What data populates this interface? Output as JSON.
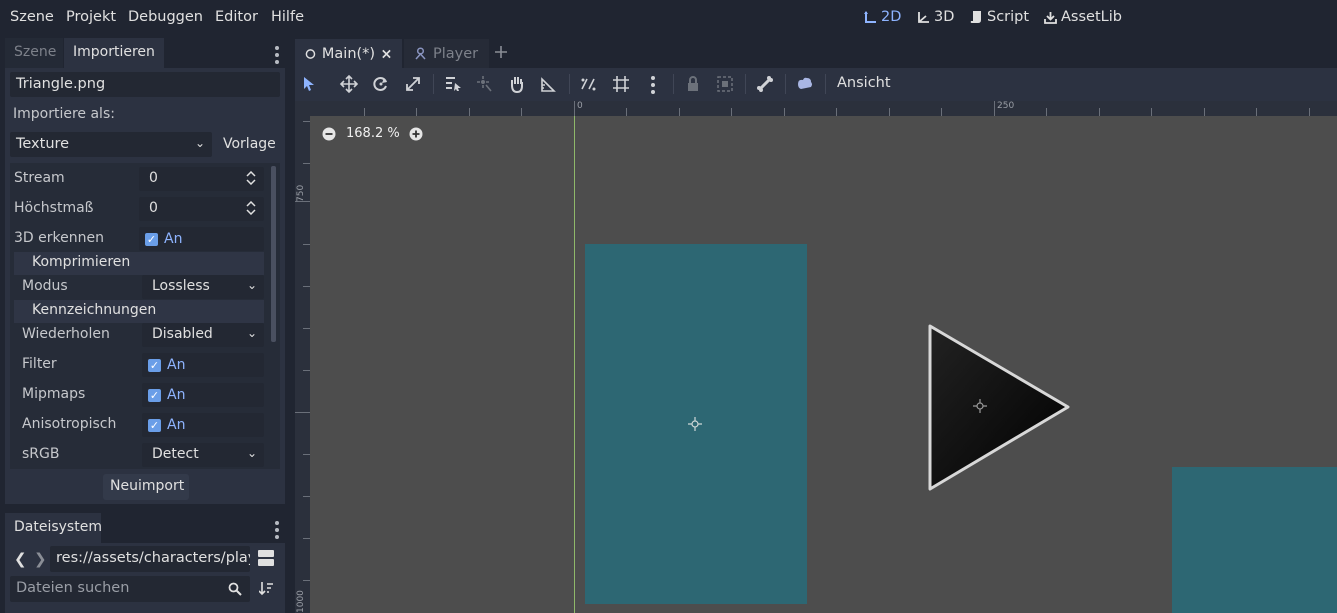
{
  "menubar": {
    "items": [
      "Szene",
      "Projekt",
      "Debuggen",
      "Editor",
      "Hilfe"
    ],
    "workspaces": [
      {
        "label": "2D",
        "icon": "2d-axis-icon",
        "active": true
      },
      {
        "label": "3D",
        "icon": "3d-axis-icon",
        "active": false
      },
      {
        "label": "Script",
        "icon": "script-icon",
        "active": false
      },
      {
        "label": "AssetLib",
        "icon": "download-icon",
        "active": false
      }
    ]
  },
  "dock_top": {
    "tabs": [
      "Szene",
      "Importieren"
    ],
    "active_tab": "Importieren",
    "file_name": "Triangle.png",
    "import_as_label": "Importiere als:",
    "import_type": "Texture",
    "preset_label": "Vorlage",
    "properties": {
      "stream": {
        "label": "Stream",
        "value": "0"
      },
      "max_size": {
        "label": "Höchstmaß",
        "value": "0"
      },
      "detect_3d": {
        "label": "3D erkennen",
        "value": "An"
      },
      "compress_section": "Komprimieren",
      "mode": {
        "label": "Modus",
        "value": "Lossless"
      },
      "flags_section": "Kennzeichnungen",
      "repeat": {
        "label": "Wiederholen",
        "value": "Disabled"
      },
      "filter": {
        "label": "Filter",
        "value": "An"
      },
      "mipmaps": {
        "label": "Mipmaps",
        "value": "An"
      },
      "anisotropic": {
        "label": "Anisotropisch",
        "value": "An"
      },
      "srgb": {
        "label": "sRGB",
        "value": "Detect"
      }
    },
    "reimport_label": "Neuimport"
  },
  "dock_bottom": {
    "tab": "Dateisystem",
    "path": "res://assets/characters/play",
    "search_placeholder": "Dateien suchen"
  },
  "main_tabs": [
    {
      "label": "Main(*)",
      "active": true
    },
    {
      "label": "Player",
      "active": false
    }
  ],
  "toolbar": {
    "view_label": "Ansicht"
  },
  "viewport": {
    "zoom": "168.2 %",
    "ruler_top_labels": [
      "0",
      "250"
    ],
    "ruler_left_labels": [
      "750",
      "1000"
    ],
    "colors": {
      "background": "#4d4d4d",
      "rect": "#2d6773",
      "triangle": "#111111",
      "origin_line": "#8fb86a"
    }
  }
}
